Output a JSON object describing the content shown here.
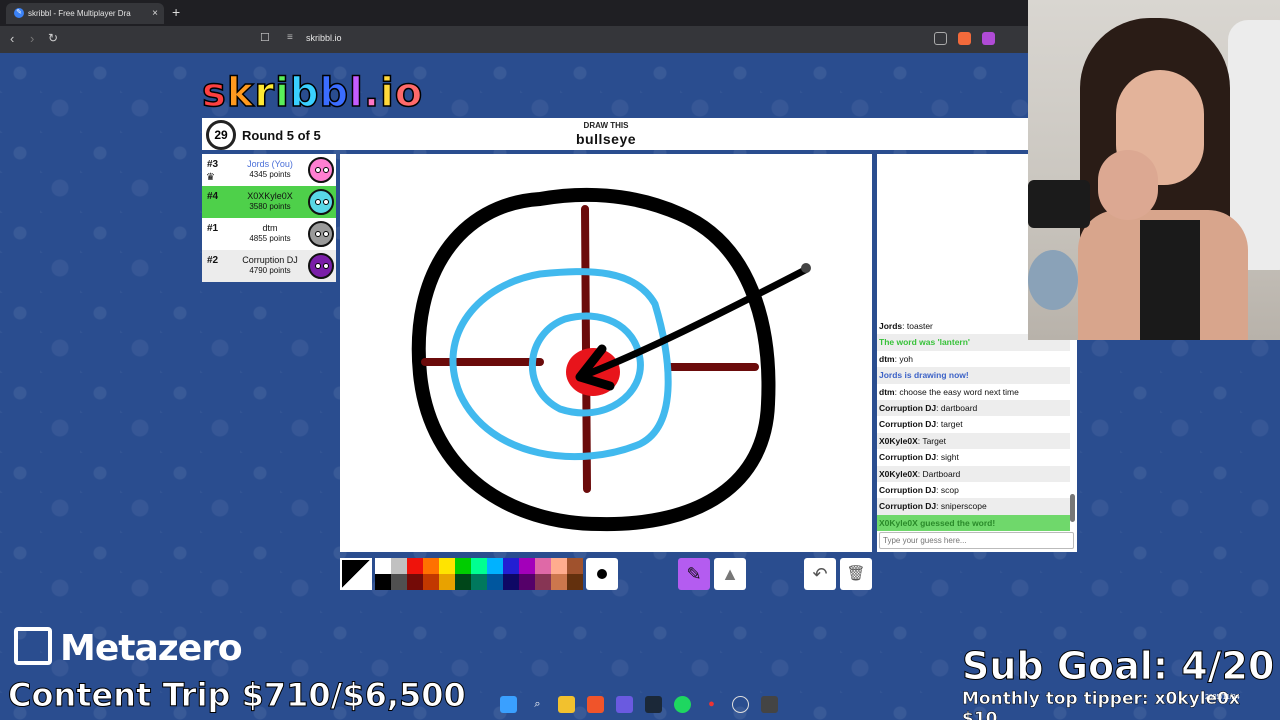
{
  "browser": {
    "tab_title": "skribbl - Free Multiplayer Dra",
    "url": "skribbl.io",
    "close_glyph": "×",
    "new_tab_glyph": "+"
  },
  "game": {
    "logo_text": "skribbl.io",
    "timer": "29",
    "round": "Round 5 of 5",
    "draw_label": "DRAW THIS",
    "word": "bullseye"
  },
  "players": [
    {
      "rank": "#3",
      "name": "Jords (You)",
      "points": "4345 points",
      "me": true,
      "color": "#ff7fd1"
    },
    {
      "rank": "#4",
      "name": "X0XKyle0X",
      "points": "3580 points",
      "guessed": true,
      "color": "#59d8e6"
    },
    {
      "rank": "#1",
      "name": "dtm",
      "points": "4855 points",
      "color": "#9a9a9a"
    },
    {
      "rank": "#2",
      "name": "Corruption DJ",
      "points": "4790 points",
      "color": "#7a1ea8"
    }
  ],
  "chat": {
    "messages": [
      {
        "user": "Jords",
        "text": "toaster"
      },
      {
        "system": "The word was 'lantern'",
        "style": "green"
      },
      {
        "user": "dtm",
        "text": "yoh"
      },
      {
        "system": "Jords is drawing now!",
        "style": "blue"
      },
      {
        "user": "dtm",
        "text": "choose the easy word next time"
      },
      {
        "user": "Corruption DJ",
        "text": "dartboard"
      },
      {
        "user": "Corruption DJ",
        "text": "target"
      },
      {
        "user": "X0Kyle0X",
        "text": "Target"
      },
      {
        "user": "Corruption DJ",
        "text": "sight"
      },
      {
        "user": "X0Kyle0X",
        "text": "Dartboard"
      },
      {
        "user": "Corruption DJ",
        "text": "scop"
      },
      {
        "user": "Corruption DJ",
        "text": "sniperscope"
      },
      {
        "system": "X0Kyle0X guessed the word!",
        "style": "guessed"
      }
    ],
    "input_placeholder": "Type your guess here..."
  },
  "palette": {
    "top": [
      "#ffffff",
      "#c1c1c1",
      "#ef130b",
      "#ff7100",
      "#ffe400",
      "#00cc00",
      "#00ff91",
      "#00b2ff",
      "#231fd3",
      "#a300ba",
      "#df69a7",
      "#ffac8e",
      "#a0522d"
    ],
    "bottom": [
      "#000000",
      "#505050",
      "#740b07",
      "#c23800",
      "#e8a200",
      "#004619",
      "#00785d",
      "#00569e",
      "#0e0865",
      "#550069",
      "#873554",
      "#cc774d",
      "#63300d"
    ]
  },
  "tools": {
    "pen_icon": "✎",
    "fill_icon": "▲",
    "undo_icon": "↶",
    "clear_icon": "🗑"
  },
  "overlay": {
    "brand": "Metazero",
    "content_trip": "Content Trip $710/$6,500",
    "sub_goal": "Sub Goal: 4/20",
    "top_tipper": "Monthly top tipper: x0kyle0x $10",
    "tray_date": "2025/11/24"
  }
}
